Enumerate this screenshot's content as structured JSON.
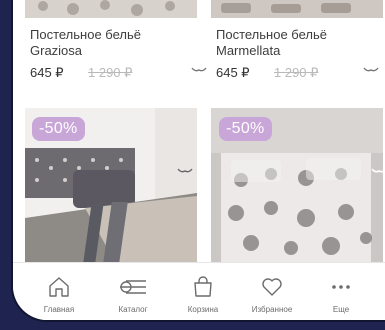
{
  "products": [
    {
      "name": "Постельное бельё Graziosa",
      "price": "645 ₽",
      "old_price": "1 290 ₽"
    },
    {
      "name": "Постельное бельё Marmellata",
      "price": "645 ₽",
      "old_price": "1 290 ₽"
    }
  ],
  "promo_cards": [
    {
      "badge": "-50%"
    },
    {
      "badge": "-50%"
    }
  ],
  "nav": [
    {
      "label": "Главная",
      "icon": "home-icon"
    },
    {
      "label": "Каталог",
      "icon": "catalog-icon"
    },
    {
      "label": "Корзина",
      "icon": "bag-icon"
    },
    {
      "label": "Избранное",
      "icon": "heart-icon"
    },
    {
      "label": "Еще",
      "icon": "more-icon"
    }
  ],
  "colors": {
    "badge": "#c9a6d8",
    "outer_background": "#1e2350"
  }
}
